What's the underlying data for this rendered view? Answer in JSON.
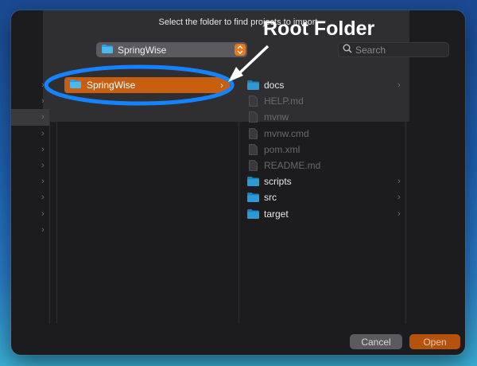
{
  "dialog": {
    "prompt": "Select the folder to find projects to import",
    "location_label": "SpringWise",
    "search_placeholder": "Search",
    "selected_folder": "SpringWise",
    "files": [
      {
        "name": "docs",
        "type": "folder",
        "dimmed": false,
        "expandable": true
      },
      {
        "name": "HELP.md",
        "type": "file",
        "dimmed": true,
        "expandable": false
      },
      {
        "name": "mvnw",
        "type": "file",
        "dimmed": true,
        "expandable": false
      },
      {
        "name": "mvnw.cmd",
        "type": "file",
        "dimmed": true,
        "expandable": false
      },
      {
        "name": "pom.xml",
        "type": "file",
        "dimmed": true,
        "expandable": false
      },
      {
        "name": "README.md",
        "type": "file",
        "dimmed": true,
        "expandable": false
      },
      {
        "name": "scripts",
        "type": "folder",
        "dimmed": false,
        "expandable": true
      },
      {
        "name": "src",
        "type": "folder",
        "dimmed": false,
        "expandable": true
      },
      {
        "name": "target",
        "type": "folder",
        "dimmed": false,
        "expandable": true
      }
    ],
    "buttons": {
      "cancel": "Cancel",
      "open": "Open"
    }
  },
  "annotation": {
    "text": "Root Folder",
    "highlight_color": "#1583ff"
  },
  "colors": {
    "accent": "#c85f10",
    "folder": "#29a3e8"
  }
}
